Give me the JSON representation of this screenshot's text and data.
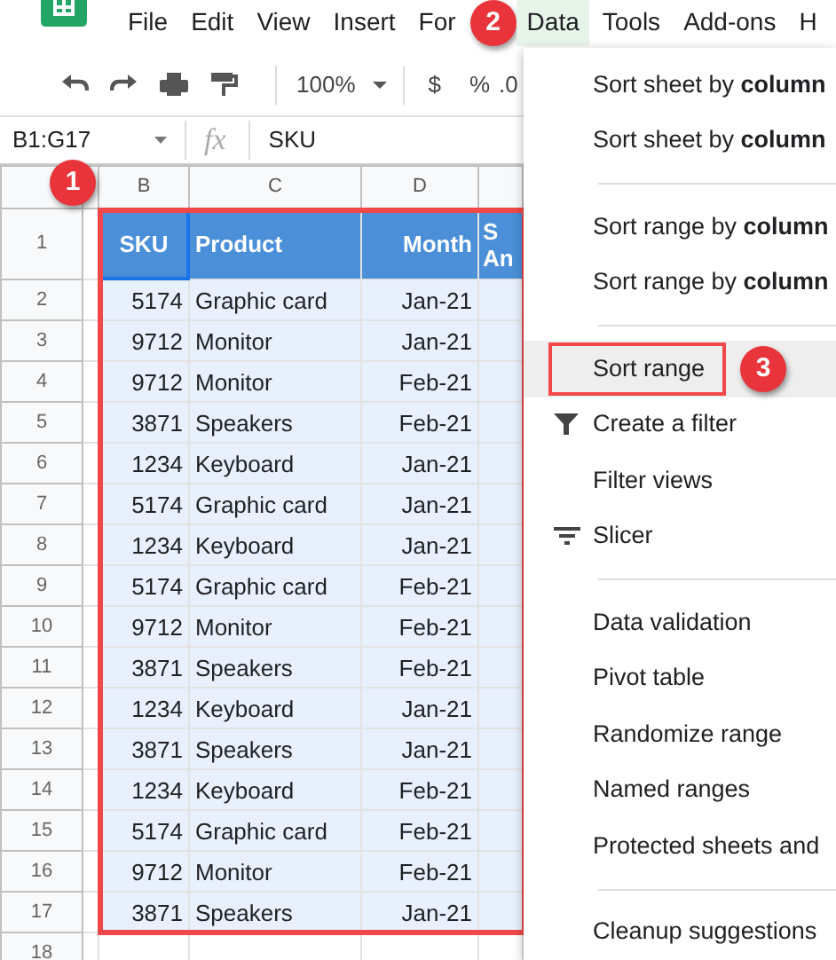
{
  "menu_bar": {
    "items": [
      {
        "label": "File",
        "selected": false
      },
      {
        "label": "Edit",
        "selected": false
      },
      {
        "label": "View",
        "selected": false
      },
      {
        "label": "Insert",
        "selected": false
      },
      {
        "label": "For",
        "selected": false
      },
      {
        "label": "Data",
        "selected": true
      },
      {
        "label": "Tools",
        "selected": false
      },
      {
        "label": "Add-ons",
        "selected": false
      },
      {
        "label": "H",
        "selected": false
      }
    ],
    "callout": "2"
  },
  "toolbar": {
    "zoom": "100%",
    "currency": "$",
    "percent": "%",
    "decimal": ".0"
  },
  "formula_bar": {
    "name_box": "B1:G17",
    "fx": "fx",
    "value": "SKU"
  },
  "sheet": {
    "callout": "1",
    "columns": [
      "B",
      "C",
      "D"
    ],
    "header": {
      "number": "1",
      "cells": [
        "SKU",
        "Product",
        "Month",
        "S An"
      ]
    },
    "rows": [
      {
        "number": "2",
        "cells": [
          "5174",
          "Graphic card",
          "Jan-21"
        ]
      },
      {
        "number": "3",
        "cells": [
          "9712",
          "Monitor",
          "Jan-21"
        ]
      },
      {
        "number": "4",
        "cells": [
          "9712",
          "Monitor",
          "Feb-21"
        ]
      },
      {
        "number": "5",
        "cells": [
          "3871",
          "Speakers",
          "Feb-21"
        ]
      },
      {
        "number": "6",
        "cells": [
          "1234",
          "Keyboard",
          "Jan-21"
        ]
      },
      {
        "number": "7",
        "cells": [
          "5174",
          "Graphic card",
          "Jan-21"
        ]
      },
      {
        "number": "8",
        "cells": [
          "1234",
          "Keyboard",
          "Jan-21"
        ]
      },
      {
        "number": "9",
        "cells": [
          "5174",
          "Graphic card",
          "Feb-21"
        ]
      },
      {
        "number": "10",
        "cells": [
          "9712",
          "Monitor",
          "Feb-21"
        ]
      },
      {
        "number": "11",
        "cells": [
          "3871",
          "Speakers",
          "Feb-21"
        ]
      },
      {
        "number": "12",
        "cells": [
          "1234",
          "Keyboard",
          "Jan-21"
        ]
      },
      {
        "number": "13",
        "cells": [
          "3871",
          "Speakers",
          "Jan-21"
        ]
      },
      {
        "number": "14",
        "cells": [
          "1234",
          "Keyboard",
          "Feb-21"
        ]
      },
      {
        "number": "15",
        "cells": [
          "5174",
          "Graphic card",
          "Feb-21"
        ]
      },
      {
        "number": "16",
        "cells": [
          "9712",
          "Monitor",
          "Feb-21"
        ]
      },
      {
        "number": "17",
        "cells": [
          "3871",
          "Speakers",
          "Jan-21"
        ]
      },
      {
        "number": "18",
        "cells": []
      }
    ]
  },
  "data_menu": [
    {
      "kind": "item",
      "label": "Sort sheet by **column**",
      "selected": false
    },
    {
      "kind": "item",
      "label": "Sort sheet by **column**",
      "selected": false
    },
    {
      "kind": "separator"
    },
    {
      "kind": "item",
      "label": "Sort range by **column**",
      "selected": false
    },
    {
      "kind": "item",
      "label": "Sort range by **column**",
      "selected": false
    },
    {
      "kind": "separator"
    },
    {
      "kind": "item",
      "label": "Sort range",
      "selected": true,
      "callout": "3"
    },
    {
      "kind": "filter",
      "label": "Create a filter",
      "selected": false
    },
    {
      "kind": "item",
      "label": "Filter views",
      "selected": false
    },
    {
      "kind": "slicer",
      "label": "Slicer",
      "selected": false
    },
    {
      "kind": "separator"
    },
    {
      "kind": "item",
      "label": "Data validation",
      "selected": false
    },
    {
      "kind": "item",
      "label": "Pivot table",
      "selected": false
    },
    {
      "kind": "item",
      "label": "Randomize range",
      "selected": false
    },
    {
      "kind": "item",
      "label": "Named ranges",
      "selected": false
    },
    {
      "kind": "item",
      "label": "Protected sheets and",
      "selected": false
    },
    {
      "kind": "separator"
    },
    {
      "kind": "item",
      "label": "Cleanup suggestions",
      "selected": false
    }
  ]
}
